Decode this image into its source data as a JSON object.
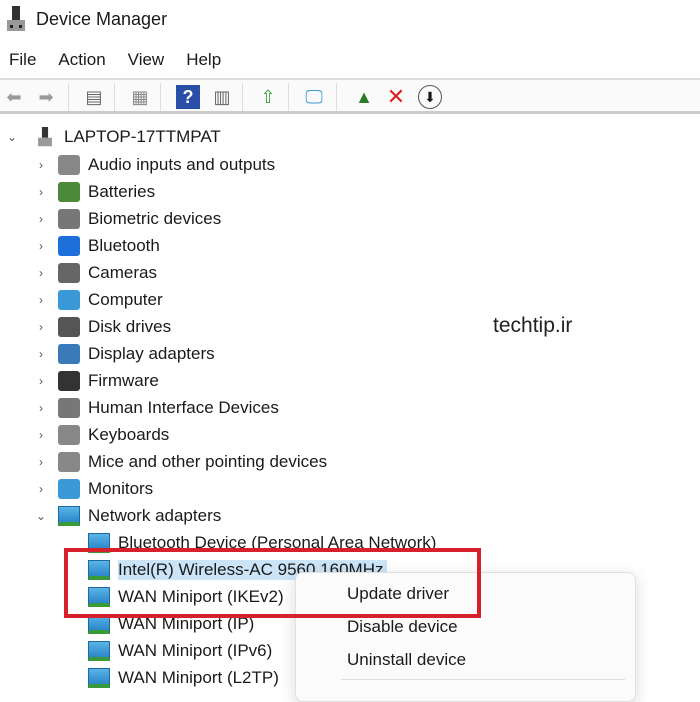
{
  "window": {
    "title": "Device Manager"
  },
  "menu": [
    "File",
    "Action",
    "View",
    "Help"
  ],
  "toolbar": {
    "icons": [
      "back-icon",
      "forward-icon",
      "show-hide-console-tree-icon",
      "properties-icon",
      "help-icon",
      "action-pane-icon",
      "update-driver-icon",
      "scan-hardware-icon",
      "enable-device-icon",
      "uninstall-icon",
      "disable-device-icon"
    ]
  },
  "tree": {
    "root": "LAPTOP-17TTMPAT",
    "categories": [
      "Audio inputs and outputs",
      "Batteries",
      "Biometric devices",
      "Bluetooth",
      "Cameras",
      "Computer",
      "Disk drives",
      "Display adapters",
      "Firmware",
      "Human Interface Devices",
      "Keyboards",
      "Mice and other pointing devices",
      "Monitors",
      "Network adapters"
    ],
    "network_children": [
      "Bluetooth Device (Personal Area Network)",
      "Intel(R) Wireless-AC 9560 160MHz",
      "WAN Miniport (IKEv2)",
      "WAN Miniport (IP)",
      "WAN Miniport (IPv6)",
      "WAN Miniport (L2TP)"
    ],
    "selected": "Intel(R) Wireless-AC 9560 160MHz"
  },
  "context_menu": [
    "Update driver",
    "Disable device",
    "Uninstall device"
  ],
  "highlight_color": "#d6202a",
  "watermark": "techtip.ir"
}
